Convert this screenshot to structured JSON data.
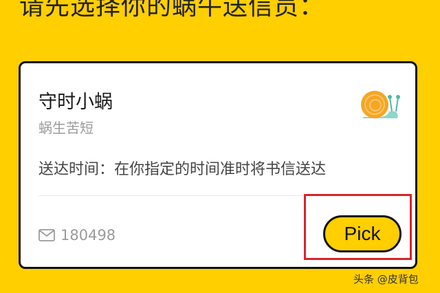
{
  "heading": "请先选择你的蜗牛送信员：",
  "courier": {
    "name": "守时小蜗",
    "tagline": "蜗生苦短",
    "description": "送达时间：在你指定的时间准时将书信送达",
    "letter_count": "180498",
    "avatar_icon": "snail-icon"
  },
  "actions": {
    "pick_label": "Pick"
  },
  "watermark": "头条 @皮背包",
  "colors": {
    "background": "#FFCF00",
    "card": "#FFFFFF",
    "button": "#FFCF00",
    "highlight": "#D8232A"
  }
}
